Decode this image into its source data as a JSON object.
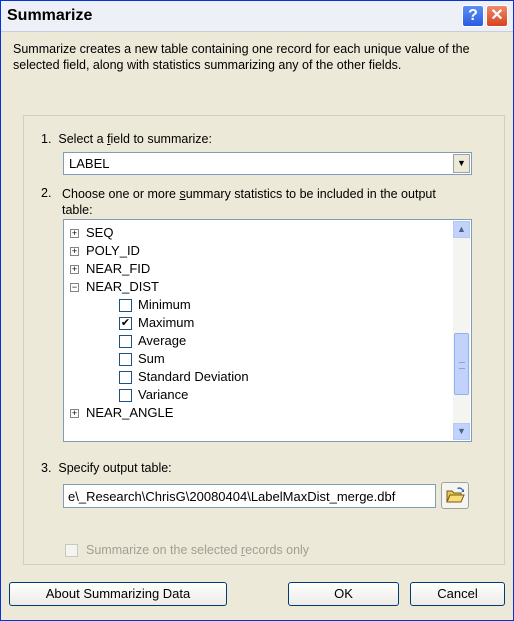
{
  "window": {
    "title": "Summarize",
    "help_glyph": "?",
    "close_glyph": "✕"
  },
  "description": "Summarize creates a new table containing one record for each unique value of the selected field, along with statistics summarizing any of the other fields.",
  "step1": {
    "num": "1.",
    "label_pre": "Select a ",
    "label_key": "f",
    "label_post": "ield to summarize:",
    "value": "LABEL"
  },
  "step2": {
    "num": "2.",
    "label_pre": "Choose one or more ",
    "label_key": "s",
    "label_post": "ummary statistics to be included in the output table:"
  },
  "tree": {
    "fields": [
      "SEQ",
      "POLY_ID",
      "NEAR_FID",
      "NEAR_DIST"
    ],
    "expanded_field": "NEAR_DIST",
    "stats": [
      {
        "label": "Minimum",
        "checked": false
      },
      {
        "label": "Maximum",
        "checked": true
      },
      {
        "label": "Average",
        "checked": false
      },
      {
        "label": "Sum",
        "checked": false
      },
      {
        "label": "Standard Deviation",
        "checked": false
      },
      {
        "label": "Variance",
        "checked": false
      }
    ],
    "partial_field": "NEAR_ANGLE",
    "plus": "+",
    "minus": "−"
  },
  "step3": {
    "num": "3.",
    "label": "Specify output table:",
    "value": "e\\_Research\\ChrisG\\20080404\\LabelMaxDist_merge.dbf"
  },
  "selected_only": {
    "pre": "Summarize on the selected ",
    "key": "r",
    "post": "ecords only",
    "checked": false,
    "enabled": false
  },
  "buttons": {
    "about": "About Summarizing Data",
    "ok": "OK",
    "cancel": "Cancel"
  },
  "colors": {
    "dialog_bg": "#ece9d8",
    "border_blue": "#0831d9",
    "close_red": "#d6431e",
    "help_blue": "#2a5de0"
  }
}
